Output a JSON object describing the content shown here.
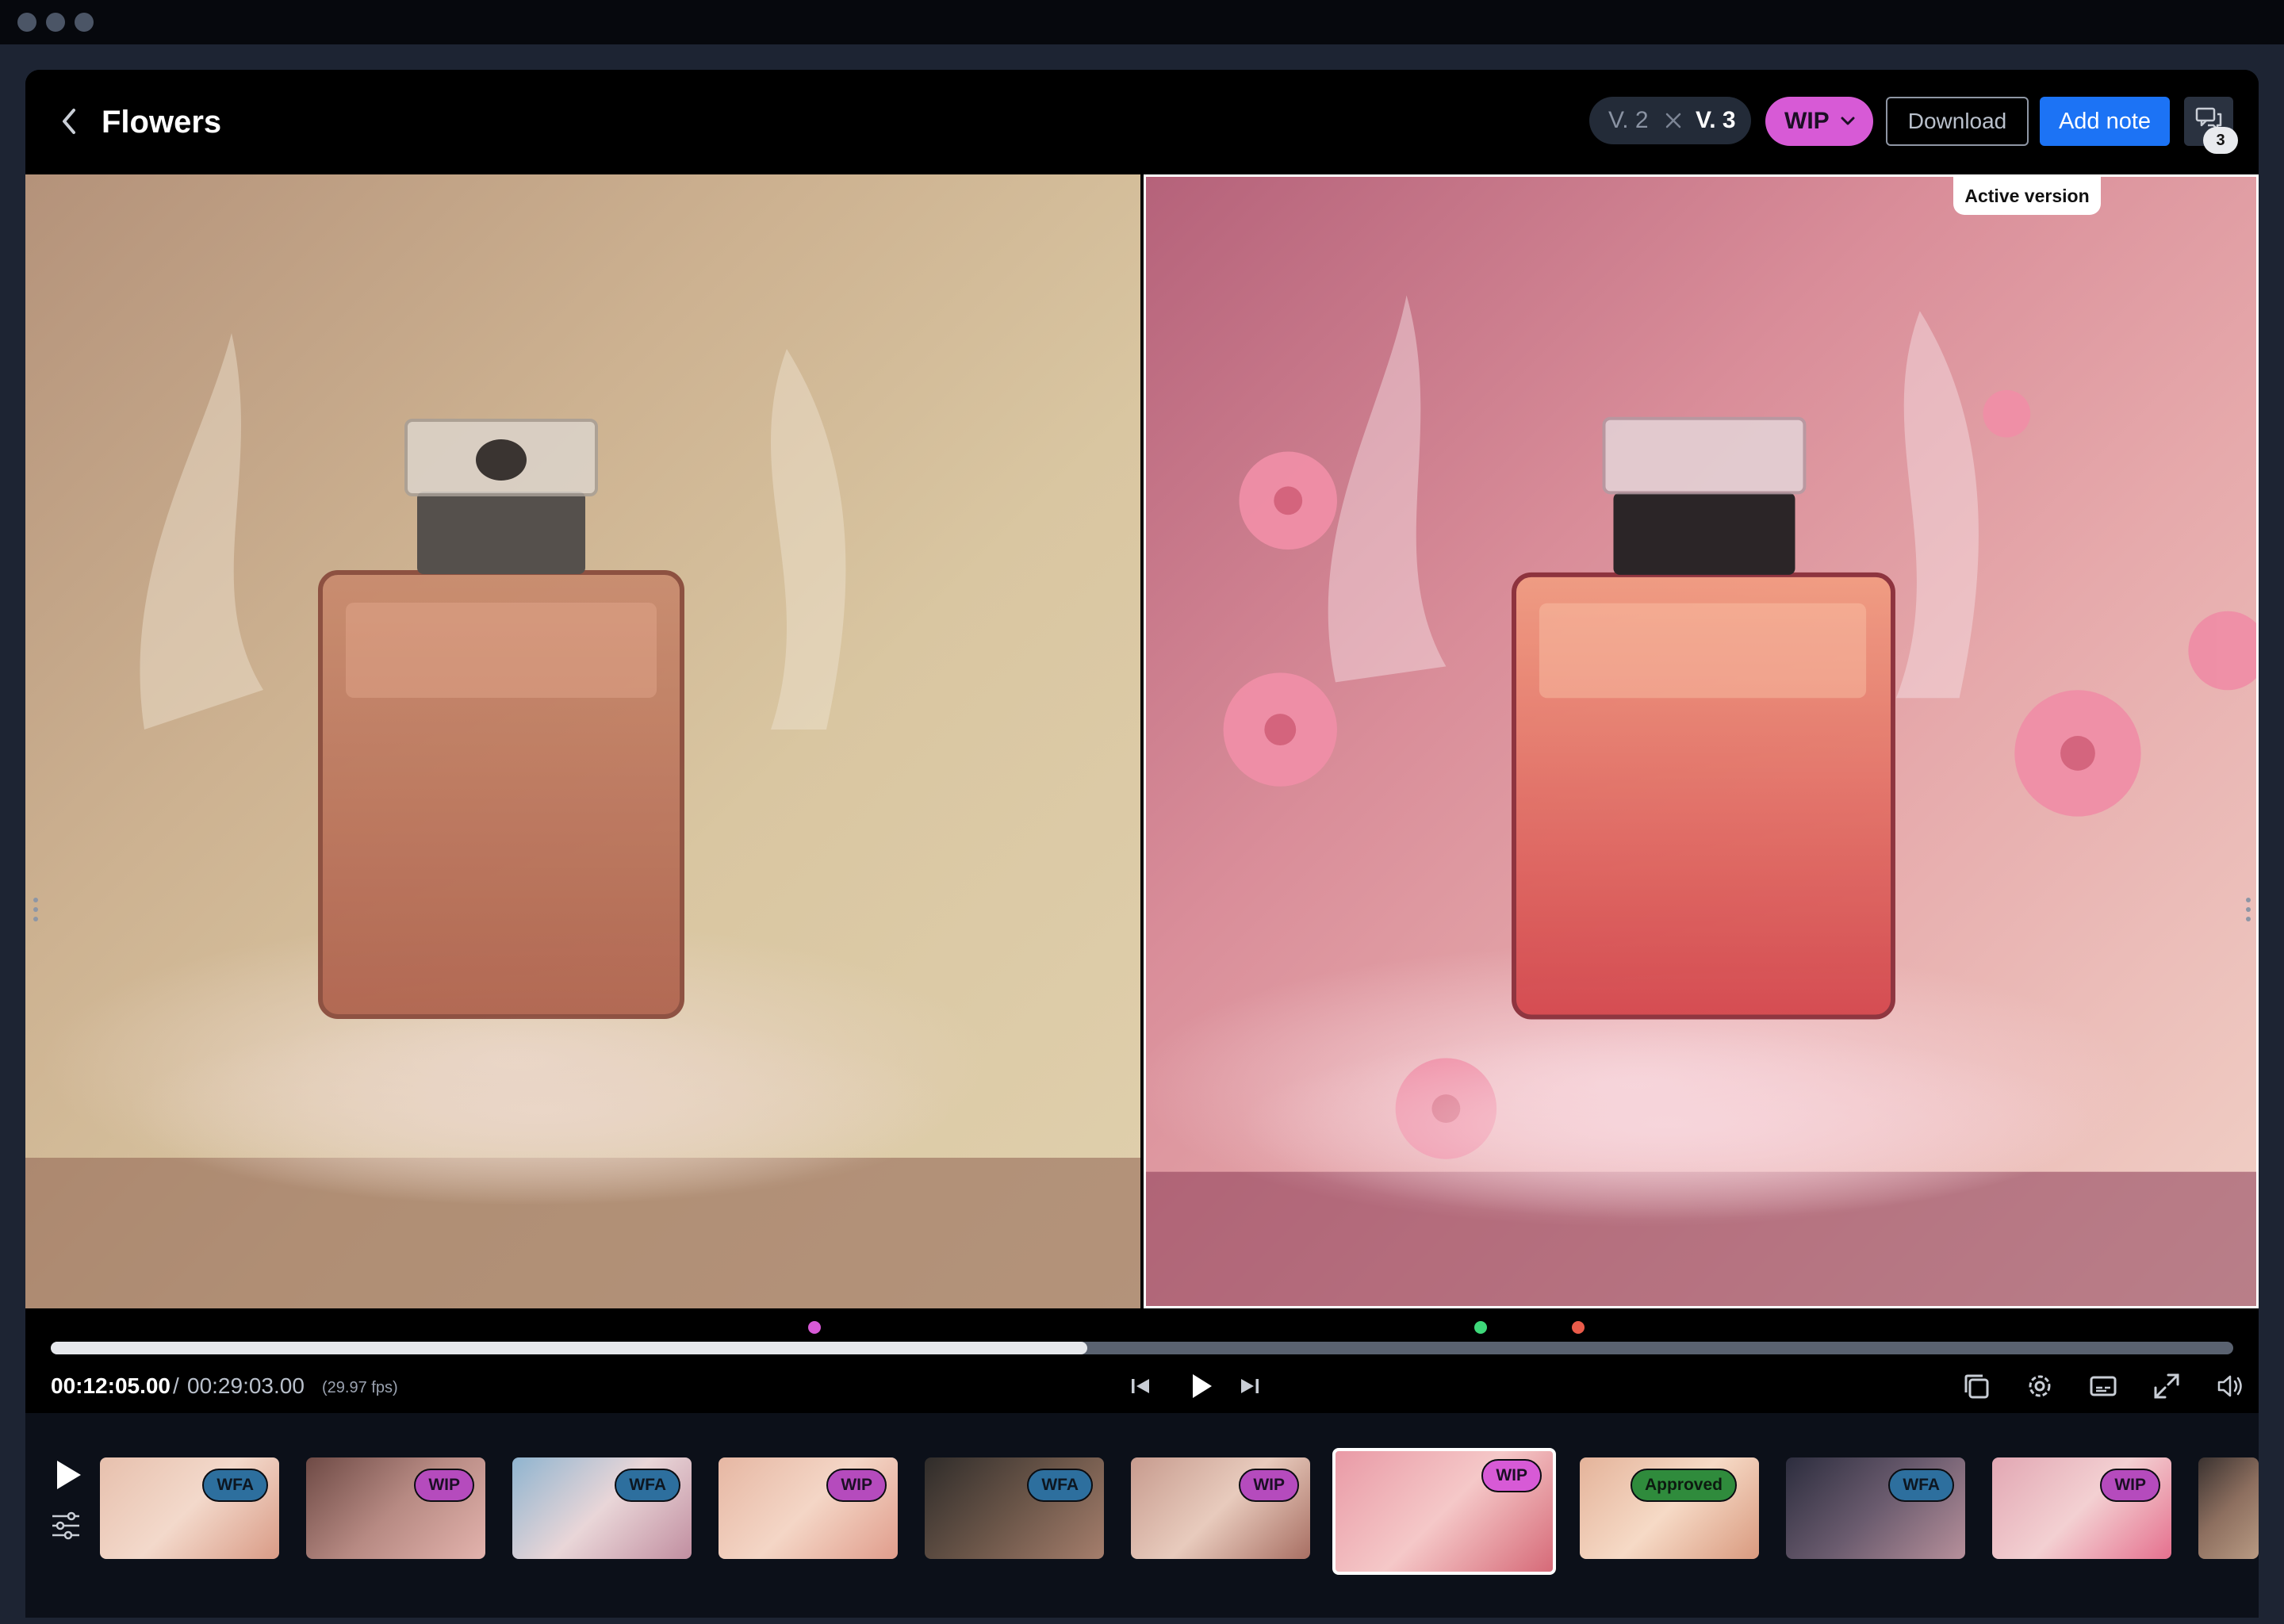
{
  "header": {
    "title": "Flowers",
    "versions": {
      "inactive": "V. 2",
      "active": "V. 3"
    },
    "status": "WIP",
    "download_label": "Download",
    "add_note_label": "Add note",
    "comments_count": "3"
  },
  "viewer": {
    "active_tooltip": "Active version"
  },
  "transport": {
    "current_time": "00:12:05.00",
    "separator": "/",
    "total_time": "00:29:03.00",
    "fps": "(29.97 fps)",
    "progress_fraction": 0.475,
    "markers": [
      {
        "position": 0.35,
        "color": "#d75ad6"
      },
      {
        "position": 0.655,
        "color": "#3ed87a"
      },
      {
        "position": 0.7,
        "color": "#ea5b4a"
      }
    ]
  },
  "filmstrip": {
    "items": [
      {
        "status": "WFA"
      },
      {
        "status": "WIP"
      },
      {
        "status": "WFA"
      },
      {
        "status": "WIP"
      },
      {
        "status": "WFA"
      },
      {
        "status": "WIP"
      },
      {
        "status": "WIP",
        "active": true
      },
      {
        "status": "Approved"
      },
      {
        "status": "WFA"
      },
      {
        "status": "WIP"
      },
      {
        "status": ""
      }
    ]
  },
  "colors": {
    "accent_blue": "#1c73f5",
    "wip_badge": "#b54bbd",
    "wip_badge_active": "#d75ad6",
    "wfa_badge": "#2d6f9e",
    "approved_badge": "#2f8b3c"
  },
  "icons": [
    "chevron-left-icon",
    "close-icon",
    "chevron-down-icon",
    "comments-icon",
    "skip-back-icon",
    "play-icon",
    "skip-forward-icon",
    "layers-icon",
    "settings-icon",
    "subtitles-icon",
    "fullscreen-icon",
    "volume-icon",
    "adjust-icon"
  ]
}
